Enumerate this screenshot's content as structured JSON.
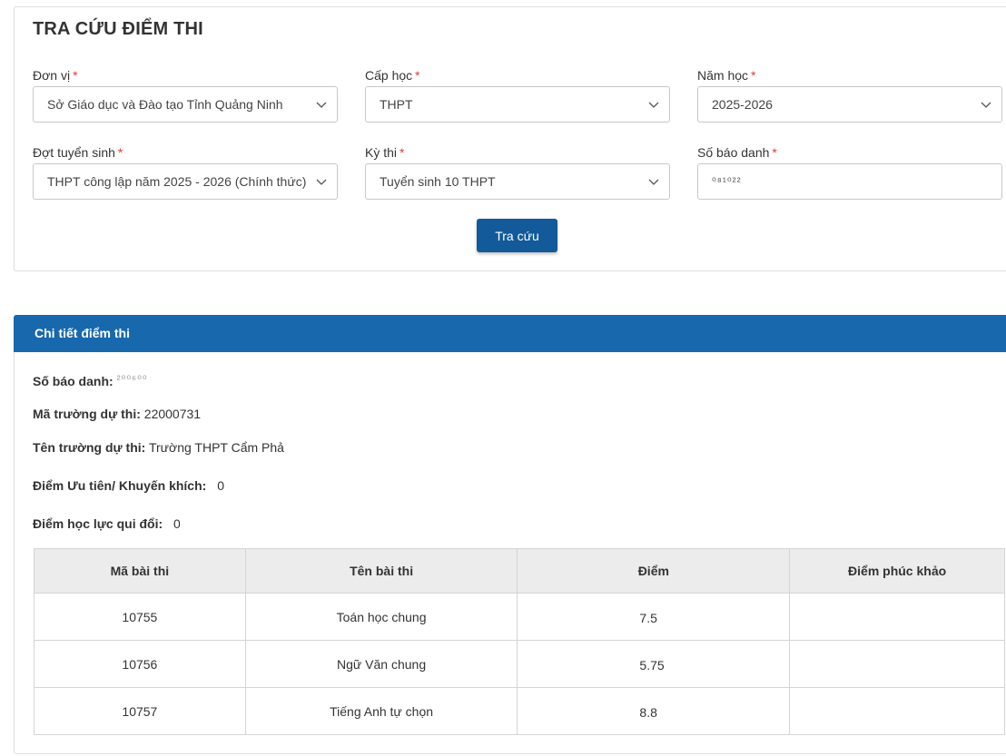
{
  "search_form": {
    "title": "TRA CỨU ĐIỂM THI",
    "required_mark": "*",
    "fields": {
      "don_vi": {
        "label": "Đơn vị",
        "value": "Sở Giáo dục và Đào tạo Tỉnh Quảng Ninh",
        "icon": "chevron-down-icon"
      },
      "cap_hoc": {
        "label": "Cấp học",
        "value": "THPT",
        "icon": "chevron-down-icon"
      },
      "nam_hoc": {
        "label": "Năm học",
        "value": "2025-2026",
        "icon": "chevron-down-icon"
      },
      "dot_tuyen_sinh": {
        "label": "Đợt tuyển sinh",
        "value": "THPT công lập năm 2025 - 2026 (Chính thức)",
        "icon": "chevron-down-icon"
      },
      "ky_thi": {
        "label": "Kỳ thi",
        "value": "Tuyển sinh 10 THPT",
        "icon": "chevron-down-icon"
      },
      "so_bao_danh": {
        "label": "Số báo danh",
        "value": "⁰⁸¹⁰²²"
      }
    },
    "submit_label": "Tra cứu"
  },
  "result": {
    "header": "Chi tiết điểm thi",
    "so_bao_danh_label": "Số báo danh:",
    "so_bao_danh_value": "²⁰⁰⁶⁰⁰",
    "ma_truong_label": "Mã trường dự thi:",
    "ma_truong_value": "22000731",
    "ten_truong_label": "Tên trường dự thi:",
    "ten_truong_value": "Trường THPT Cẩm Phả",
    "uu_tien_label": "Điểm Ưu tiên/ Khuyến khích:",
    "uu_tien_value": "0",
    "hoc_luc_label": "Điểm học lực qui đổi:",
    "hoc_luc_value": "0",
    "table": {
      "headers": [
        "Mã bài thi",
        "Tên bài thi",
        "Điểm",
        "Điểm phúc khảo"
      ],
      "rows": [
        {
          "ma": "10755",
          "ten": "Toán học chung",
          "diem": "7.5",
          "phuc_khao": ""
        },
        {
          "ma": "10756",
          "ten": "Ngữ Văn chung",
          "diem": "5.75",
          "phuc_khao": ""
        },
        {
          "ma": "10757",
          "ten": "Tiếng Anh tự chọn",
          "diem": "8.8",
          "phuc_khao": ""
        }
      ]
    }
  },
  "colors": {
    "primary": "#125a99",
    "header_bar": "#1868ae",
    "required": "#e53935",
    "table_header_bg": "#ececec"
  }
}
